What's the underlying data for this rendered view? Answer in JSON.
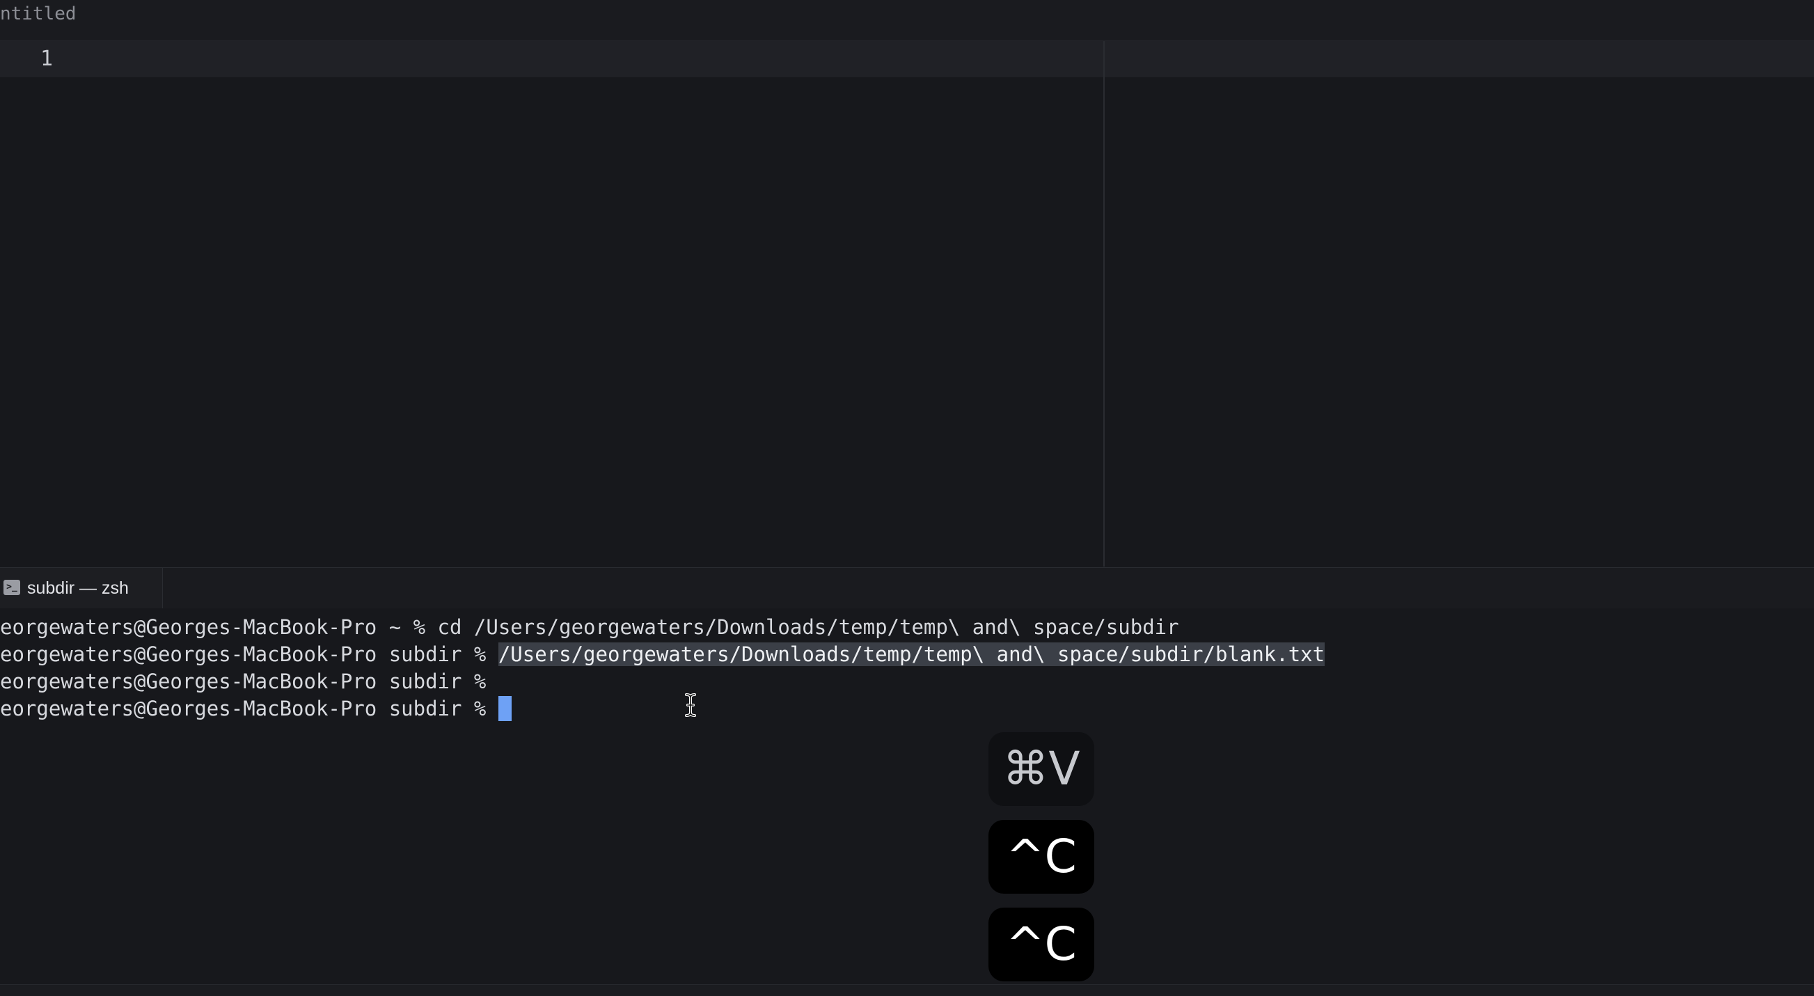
{
  "editor": {
    "tab_title": "ntitled",
    "left_pane": {
      "line_number": "1"
    }
  },
  "terminal": {
    "tab_label": "subdir — zsh",
    "tab_icon": "terminal-icon",
    "lines": [
      {
        "prompt": "eorgewaters@Georges-MacBook-Pro ~ % ",
        "text": "cd /Users/georgewaters/Downloads/temp/temp\\ and\\ space/subdir"
      },
      {
        "prompt": "eorgewaters@Georges-MacBook-Pro subdir % ",
        "text": "/Users/georgewaters/Downloads/temp/temp\\ and\\ space/subdir/blank.txt"
      },
      {
        "prompt": "eorgewaters@Georges-MacBook-Pro subdir % ",
        "text": ""
      },
      {
        "prompt": "eorgewaters@Georges-MacBook-Pro subdir % ",
        "text": ""
      }
    ]
  },
  "keystrokes": {
    "first": "⌘V",
    "second": "^C",
    "third": "^C"
  },
  "colors": {
    "background": "#17181c",
    "cursor": "#6ea1f5",
    "selection": "#3b3f47"
  }
}
